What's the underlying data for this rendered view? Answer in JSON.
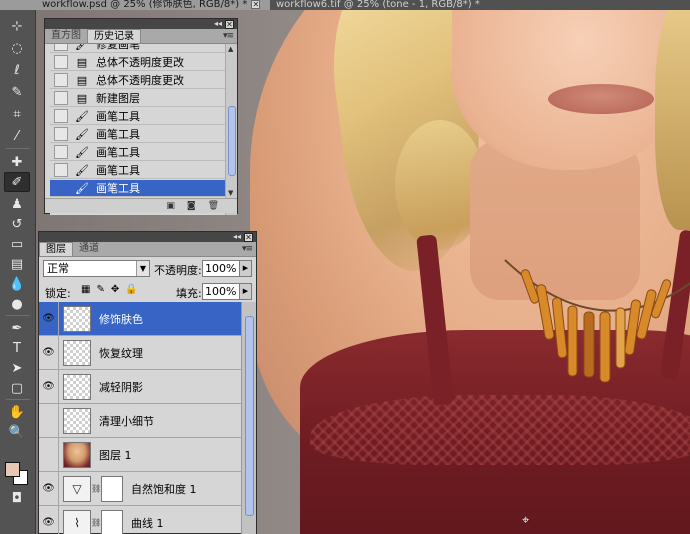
{
  "colors": {
    "selection": "#3764c5",
    "panel_bg": "#d6d6d6",
    "toolbox_bg": "#535353",
    "foreground_color": "#e9c7b6",
    "background_color": "#ffffff"
  },
  "doc_tabs": [
    {
      "title": "workflow.psd @ 25% (修饰肤色, RGB/8*) *",
      "active": true
    },
    {
      "title": "workflow6.tif @ 25% (tone - 1, RGB/8*) *",
      "active": false
    }
  ],
  "tools": [
    {
      "icon": "move-tool-icon",
      "glyph": "⊹"
    },
    {
      "icon": "marquee-tool-icon",
      "glyph": "◌"
    },
    {
      "icon": "lasso-tool-icon",
      "glyph": "ℓ"
    },
    {
      "icon": "quick-select-tool-icon",
      "glyph": "✎"
    },
    {
      "icon": "crop-tool-icon",
      "glyph": "⌗"
    },
    {
      "icon": "eyedropper-tool-icon",
      "glyph": "⁄"
    },
    {
      "icon": "healing-brush-tool-icon",
      "glyph": "✚"
    },
    {
      "icon": "brush-tool-icon",
      "glyph": "✐"
    },
    {
      "icon": "clone-stamp-tool-icon",
      "glyph": "♟"
    },
    {
      "icon": "history-brush-tool-icon",
      "glyph": "↺"
    },
    {
      "icon": "eraser-tool-icon",
      "glyph": "▭"
    },
    {
      "icon": "gradient-tool-icon",
      "glyph": "▤"
    },
    {
      "icon": "blur-tool-icon",
      "glyph": "💧"
    },
    {
      "icon": "dodge-tool-icon",
      "glyph": "●"
    },
    {
      "icon": "pen-tool-icon",
      "glyph": "✒"
    },
    {
      "icon": "type-tool-icon",
      "glyph": "T"
    },
    {
      "icon": "path-select-tool-icon",
      "glyph": "➤"
    },
    {
      "icon": "shape-tool-icon",
      "glyph": "▢"
    },
    {
      "icon": "hand-tool-icon",
      "glyph": "✋"
    },
    {
      "icon": "zoom-tool-icon",
      "glyph": "🔍"
    },
    {
      "icon": "screen-mode-icon",
      "glyph": "◘"
    }
  ],
  "history_panel": {
    "tabs": [
      "直方图",
      "历史记录"
    ],
    "active_tab": 1,
    "items": [
      {
        "label": "修复画笔",
        "icon": "brush-history-icon"
      },
      {
        "label": "总体不透明度更改",
        "icon": "document-history-icon"
      },
      {
        "label": "总体不透明度更改",
        "icon": "document-history-icon"
      },
      {
        "label": "新建图层",
        "icon": "document-history-icon"
      },
      {
        "label": "画笔工具",
        "icon": "brush-history-icon"
      },
      {
        "label": "画笔工具",
        "icon": "brush-history-icon"
      },
      {
        "label": "画笔工具",
        "icon": "brush-history-icon"
      },
      {
        "label": "画笔工具",
        "icon": "brush-history-icon"
      },
      {
        "label": "画笔工具",
        "icon": "brush-history-icon",
        "selected": true
      }
    ],
    "footer_icons": [
      "new-document-icon",
      "snapshot-icon",
      "trash-icon"
    ]
  },
  "layers_panel": {
    "tabs": [
      "图层",
      "通道"
    ],
    "active_tab": 0,
    "blend_mode": "正常",
    "opacity_label": "不透明度:",
    "opacity_value": "100%",
    "lock_label": "锁定:",
    "fill_label": "填充:",
    "fill_value": "100%",
    "layers": [
      {
        "name": "修饰肤色",
        "visible": true,
        "thumb": "transparent",
        "selected": true
      },
      {
        "name": "恢复纹理",
        "visible": true,
        "thumb": "transparent"
      },
      {
        "name": "减轻阴影",
        "visible": true,
        "thumb": "transparent"
      },
      {
        "name": "清理小细节",
        "visible": false,
        "thumb": "transparent"
      },
      {
        "name": "图层 1",
        "visible": false,
        "thumb": "photo"
      },
      {
        "name": "自然饱和度 1",
        "visible": true,
        "thumb": "adjustment",
        "adj_glyph": "▽"
      },
      {
        "name": "曲线 1",
        "visible": true,
        "thumb": "adjustment",
        "adj_glyph": "⌇"
      }
    ]
  }
}
